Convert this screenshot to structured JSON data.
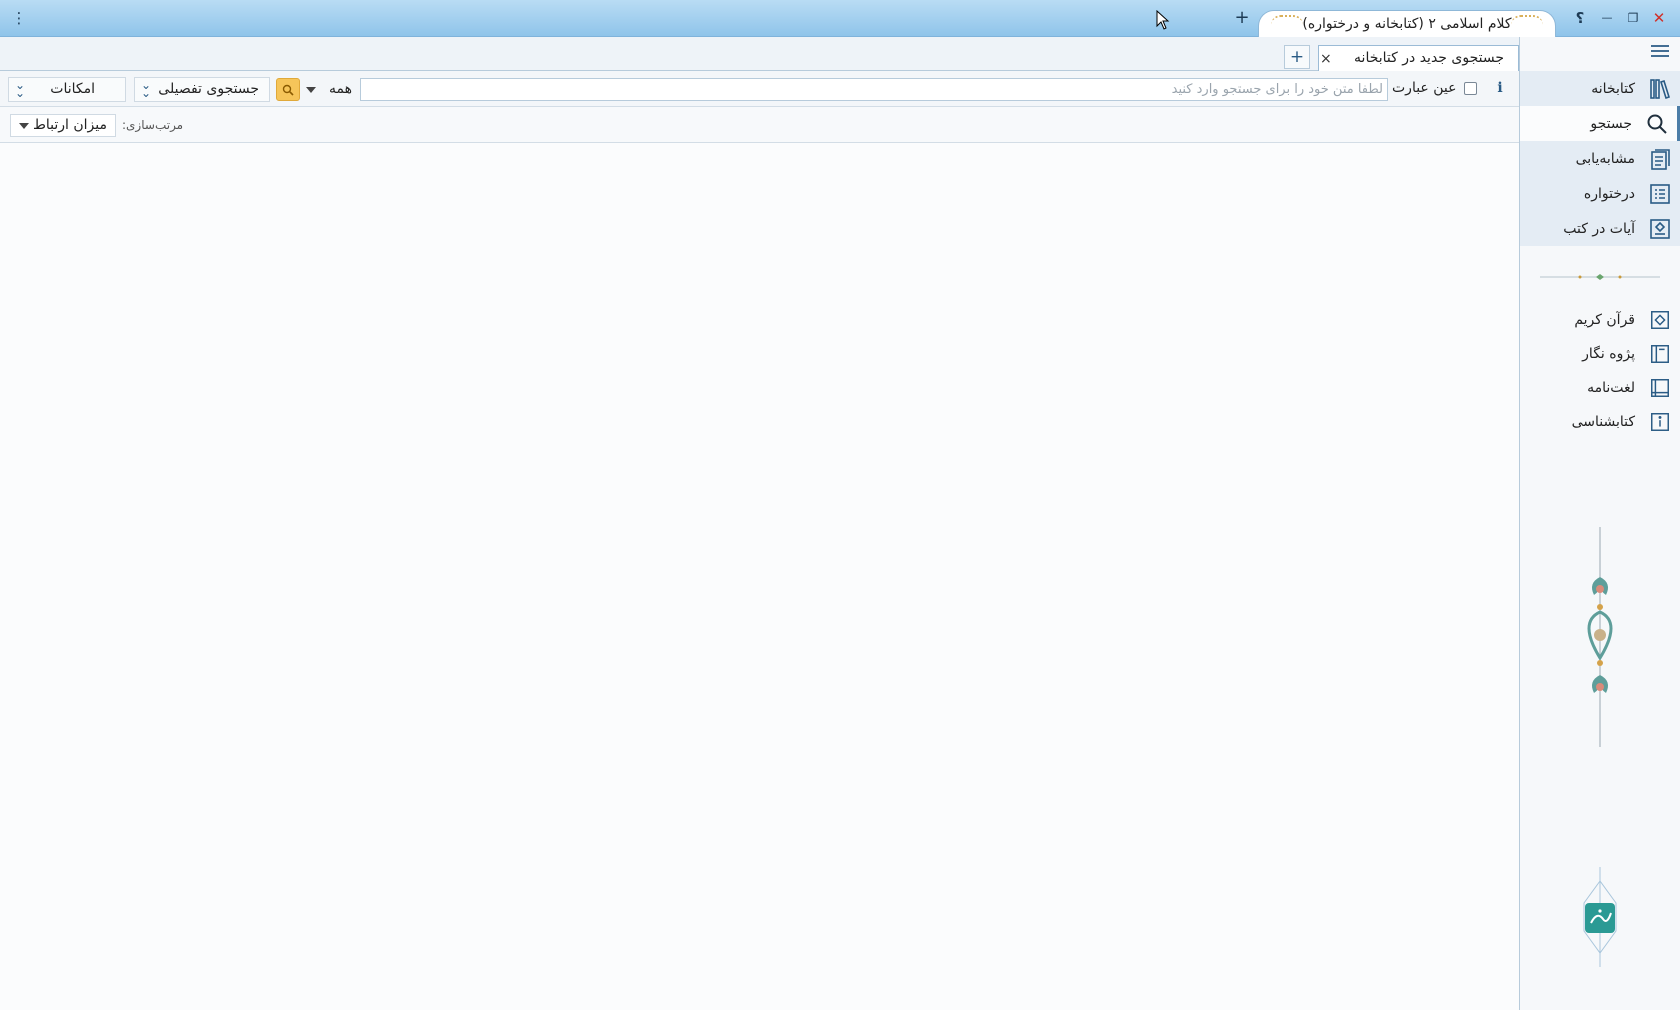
{
  "titlebar": {
    "app_tab_title": "کلام اسلامی ۲ (کتابخانه و درختواره)",
    "add_tab": "+",
    "help": "؟",
    "minimize": "—",
    "restore": "❐",
    "close": "✕",
    "menu": "⋮"
  },
  "tabs": {
    "active_tab": "جستجوی جدید در کتابخانه",
    "close": "×",
    "add": "+"
  },
  "toolbar": {
    "info": "i",
    "exact_phrase_label": "عین عبارت",
    "exact_phrase_checked": false,
    "search_placeholder": "لطفا متن خود را برای جستجو وارد کنید",
    "search_value": "",
    "scope_value": "همه",
    "advanced_search": "جستجوی تفصیلی",
    "features": "امکانات"
  },
  "sortbar": {
    "label": "مرتب‌سازی:",
    "value": "میزان ارتباط"
  },
  "sidebar": {
    "top_items": [
      {
        "label": "کتابخانه",
        "icon": "library-icon"
      },
      {
        "label": "جستجو",
        "icon": "search-icon"
      },
      {
        "label": "مشابه‌یابی",
        "icon": "similarity-icon"
      },
      {
        "label": "درختواره",
        "icon": "tree-document-icon"
      },
      {
        "label": "آیات در کتب",
        "icon": "verses-in-books-icon"
      }
    ],
    "bottom_items": [
      {
        "label": "قرآن کریم",
        "icon": "quran-icon"
      },
      {
        "label": "پژوه نگار",
        "icon": "notebook-icon"
      },
      {
        "label": "لغت‌نامه",
        "icon": "dictionary-icon"
      },
      {
        "label": "کتابشناسی",
        "icon": "bibliography-icon"
      }
    ]
  },
  "colors": {
    "titlebar": "#8fc4ea",
    "accent": "#2a5b85",
    "search_button": "#f6c55a",
    "logo": "#2b9a94"
  }
}
